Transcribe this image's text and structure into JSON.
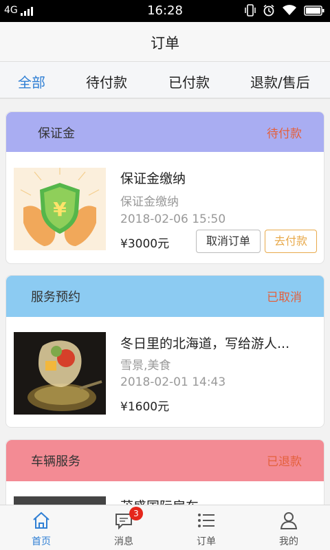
{
  "status_bar": {
    "network": "4G",
    "time": "16:28"
  },
  "nav": {
    "title": "订单"
  },
  "tabs": [
    {
      "label": "全部",
      "active": true
    },
    {
      "label": "待付款",
      "active": false
    },
    {
      "label": "已付款",
      "active": false
    },
    {
      "label": "退款/售后",
      "active": false
    }
  ],
  "orders": [
    {
      "type": "保证金",
      "status": "待付款",
      "header_color": "#a9adf2",
      "title": "保证金缴纳",
      "subtitle": "保证金缴纳",
      "date": "2018-02-06 15:50",
      "price": "¥3000元",
      "cancel_label": "取消订单",
      "pay_label": "去付款"
    },
    {
      "type": "服务预约",
      "status": "已取消",
      "header_color": "#8ccbf2",
      "title": "冬日里的北海道，写给游人...",
      "subtitle": "雪景,美食",
      "date": "2018-02-01 14:43",
      "price": "¥1600元"
    },
    {
      "type": "车辆服务",
      "status": "已退款",
      "header_color": "#f38b94",
      "title": "茂盛国际房车"
    }
  ],
  "tabbar": [
    {
      "label": "首页",
      "icon": "home-icon",
      "active": true
    },
    {
      "label": "消息",
      "icon": "message-icon",
      "badge": "3"
    },
    {
      "label": "订单",
      "icon": "list-icon"
    },
    {
      "label": "我的",
      "icon": "user-icon"
    }
  ]
}
